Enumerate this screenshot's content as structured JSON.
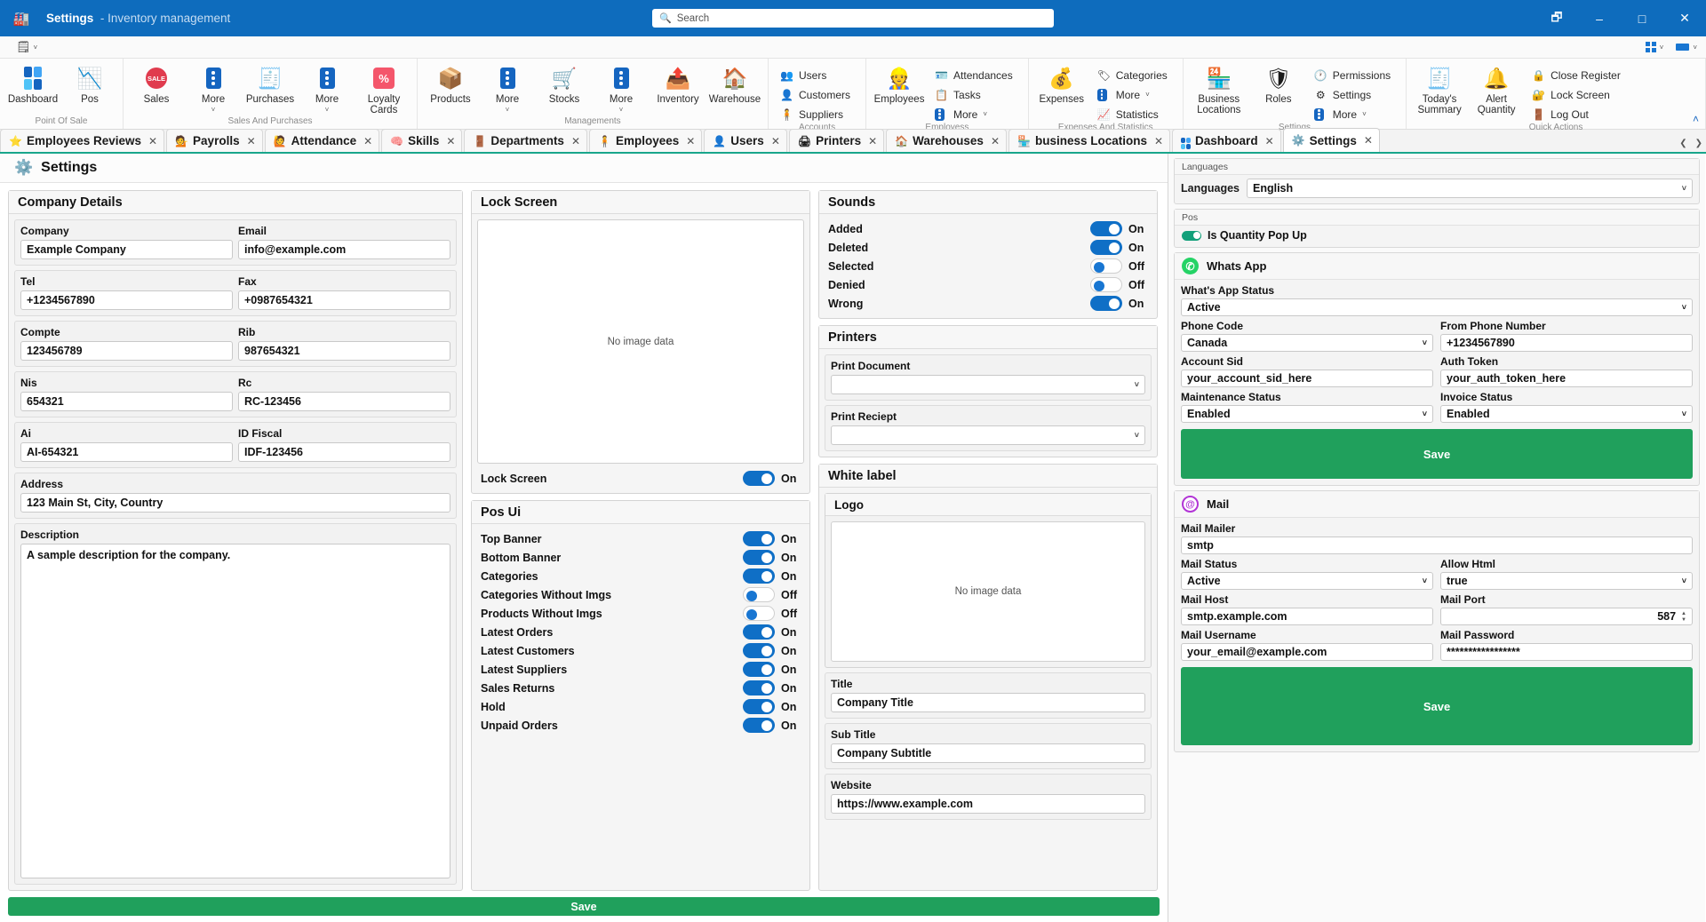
{
  "titlebar": {
    "app_icon": "factory-icon",
    "title": "Settings",
    "subtitle": "- Inventory management",
    "search_placeholder": "Search",
    "buttons": [
      "panel-icon",
      "minimize",
      "maximize",
      "close"
    ]
  },
  "ribbon_strip": {
    "menu_icon": "hamburger-doc-icon",
    "right_chips": [
      "grid-view",
      "blue-bar-view"
    ]
  },
  "ribbon": {
    "groups": [
      {
        "label": "Point Of Sale",
        "big": [
          {
            "icon": "dashboard-icon",
            "label": "Dashboard"
          },
          {
            "icon": "pos-icon",
            "label": "Pos"
          }
        ]
      },
      {
        "label": "Sales And Purchases",
        "big": [
          {
            "icon": "sale-badge-icon",
            "label": "Sales"
          },
          {
            "icon": "more-dots-icon",
            "label": "More",
            "chevron": true
          },
          {
            "icon": "purchases-icon",
            "label": "Purchases"
          },
          {
            "icon": "more-dots-icon",
            "label": "More",
            "chevron": true
          },
          {
            "icon": "percent-icon",
            "label": "Loyalty Cards"
          }
        ]
      },
      {
        "label": "Managements",
        "big": [
          {
            "icon": "products-box-icon",
            "label": "Products"
          },
          {
            "icon": "more-dots-icon",
            "label": "More",
            "chevron": true
          },
          {
            "icon": "stocks-cart-icon",
            "label": "Stocks"
          },
          {
            "icon": "more-dots-icon",
            "label": "More",
            "chevron": true
          },
          {
            "icon": "inventory-icon",
            "label": "Inventory"
          },
          {
            "icon": "warehouse-icon",
            "label": "Warehouse"
          }
        ]
      },
      {
        "label": "Accounts",
        "small": [
          {
            "icon": "users-icon",
            "label": "Users"
          },
          {
            "icon": "customers-icon",
            "label": "Customers"
          },
          {
            "icon": "suppliers-icon",
            "label": "Suppliers"
          }
        ]
      },
      {
        "label": "Employess",
        "big": [
          {
            "icon": "employee-icon",
            "label": "Employees"
          }
        ],
        "small": [
          {
            "icon": "attendances-icon",
            "label": "Attendances"
          },
          {
            "icon": "tasks-icon",
            "label": "Tasks"
          },
          {
            "icon": "more-dots-icon",
            "label": "More",
            "chevron": true
          }
        ]
      },
      {
        "label": "Expenses And Statistics",
        "big": [
          {
            "icon": "expenses-icon",
            "label": "Expenses"
          }
        ],
        "small": [
          {
            "icon": "categories-tag-icon",
            "label": "Categories"
          },
          {
            "icon": "more-dots-icon",
            "label": "More",
            "chevron": true
          },
          {
            "icon": "statistics-icon",
            "label": "Statistics"
          }
        ]
      },
      {
        "label": "Settings",
        "big": [
          {
            "icon": "business-locations-icon",
            "label": "Business Locations"
          },
          {
            "icon": "roles-shield-icon",
            "label": "Roles"
          }
        ],
        "small": [
          {
            "icon": "permissions-icon",
            "label": "Permissions"
          },
          {
            "icon": "settings-gear-icon",
            "label": "Settings"
          },
          {
            "icon": "more-dots-icon",
            "label": "More",
            "chevron": true
          }
        ]
      },
      {
        "label": "Quick Actions",
        "big": [
          {
            "icon": "todays-summary-icon",
            "label": "Today's Summary"
          },
          {
            "icon": "alert-quantity-icon",
            "label": "Alert Quantity"
          }
        ],
        "small": [
          {
            "icon": "close-register-icon",
            "label": "Close Register"
          },
          {
            "icon": "lock-screen-icon",
            "label": "Lock Screen"
          },
          {
            "icon": "log-out-icon",
            "label": "Log Out"
          }
        ]
      }
    ]
  },
  "tabs": [
    {
      "icon": "star-icon",
      "label": "Employees Reviews",
      "active": false
    },
    {
      "icon": "payroll-icon",
      "label": "Payrolls",
      "active": false
    },
    {
      "icon": "attendance-icon",
      "label": "Attendance",
      "active": false
    },
    {
      "icon": "brain-icon",
      "label": "Skills",
      "active": false
    },
    {
      "icon": "department-icon",
      "label": "Departments",
      "active": false
    },
    {
      "icon": "employee-icon",
      "label": "Employees",
      "active": false
    },
    {
      "icon": "user-icon",
      "label": "Users",
      "active": false
    },
    {
      "icon": "printer-icon",
      "label": "Printers",
      "active": false
    },
    {
      "icon": "warehouse-icon",
      "label": "Warehouses",
      "active": false
    },
    {
      "icon": "store-icon",
      "label": "business Locations",
      "active": false
    },
    {
      "icon": "dashboard-icon",
      "label": "Dashboard",
      "active": false
    },
    {
      "icon": "settings-gear-icon",
      "label": "Settings",
      "active": true
    }
  ],
  "page": {
    "icon": "settings-gear-icon",
    "title": "Settings"
  },
  "company_details": {
    "header": "Company Details",
    "fields": [
      {
        "label": "Company",
        "value": "Example Company"
      },
      {
        "label": "Email",
        "value": "info@example.com"
      },
      {
        "label": "Tel",
        "value": "+1234567890"
      },
      {
        "label": "Fax",
        "value": "+0987654321"
      },
      {
        "label": "Compte",
        "value": "123456789"
      },
      {
        "label": "Rib",
        "value": "987654321"
      },
      {
        "label": "Nis",
        "value": "654321"
      },
      {
        "label": "Rc",
        "value": "RC-123456"
      },
      {
        "label": "Ai",
        "value": "AI-654321"
      },
      {
        "label": "ID Fiscal",
        "value": "IDF-123456"
      }
    ],
    "address": {
      "label": "Address",
      "value": "123 Main St, City, Country"
    },
    "description": {
      "label": "Description",
      "value": "A sample description for the company."
    }
  },
  "lock_screen": {
    "header": "Lock Screen",
    "image_placeholder": "No image data",
    "toggle": {
      "label": "Lock Screen",
      "state": "On",
      "on": true
    }
  },
  "pos_ui": {
    "header": "Pos Ui",
    "toggles": [
      {
        "label": "Top Banner",
        "state": "On",
        "on": true
      },
      {
        "label": "Bottom Banner",
        "state": "On",
        "on": true
      },
      {
        "label": "Categories",
        "state": "On",
        "on": true
      },
      {
        "label": "Categories Without Imgs",
        "state": "Off",
        "on": false
      },
      {
        "label": "Products Without Imgs",
        "state": "Off",
        "on": false
      },
      {
        "label": "Latest Orders",
        "state": "On",
        "on": true
      },
      {
        "label": "Latest Customers",
        "state": "On",
        "on": true
      },
      {
        "label": "Latest Suppliers",
        "state": "On",
        "on": true
      },
      {
        "label": "Sales Returns",
        "state": "On",
        "on": true
      },
      {
        "label": "Hold",
        "state": "On",
        "on": true
      },
      {
        "label": "Unpaid Orders",
        "state": "On",
        "on": true
      }
    ]
  },
  "sounds": {
    "header": "Sounds",
    "toggles": [
      {
        "label": "Added",
        "state": "On",
        "on": true
      },
      {
        "label": "Deleted",
        "state": "On",
        "on": true
      },
      {
        "label": "Selected",
        "state": "Off",
        "on": false
      },
      {
        "label": "Denied",
        "state": "Off",
        "on": false
      },
      {
        "label": "Wrong",
        "state": "On",
        "on": true
      }
    ]
  },
  "printers": {
    "header": "Printers",
    "selects": [
      {
        "label": "Print Document",
        "value": ""
      },
      {
        "label": "Print Reciept",
        "value": ""
      }
    ]
  },
  "white_label": {
    "header": "White label",
    "logo": {
      "header": "Logo",
      "image_placeholder": "No image data"
    },
    "fields": [
      {
        "label": "Title",
        "value": "Company Title"
      },
      {
        "label": "Sub Title",
        "value": "Company Subtitle"
      },
      {
        "label": "Website",
        "value": "https://www.example.com"
      }
    ]
  },
  "main_save": {
    "label": "Save"
  },
  "right_panel": {
    "languages": {
      "header": "Languages",
      "label": "Languages",
      "value": "English"
    },
    "pos": {
      "header": "Pos",
      "toggle": {
        "label": "Is Quantity Pop Up",
        "on": true
      }
    },
    "whatsapp": {
      "icon": "whatsapp-icon",
      "title": "Whats App",
      "fields": [
        {
          "label": "What's App Status",
          "value": "Active",
          "type": "select",
          "full": true
        },
        {
          "label": "Phone Code",
          "value": "Canada",
          "type": "select"
        },
        {
          "label": "From Phone Number",
          "value": "+1234567890",
          "type": "input"
        },
        {
          "label": "Account Sid",
          "value": "your_account_sid_here",
          "type": "input"
        },
        {
          "label": "Auth Token",
          "value": "your_auth_token_here",
          "type": "input"
        },
        {
          "label": "Maintenance Status",
          "value": "Enabled",
          "type": "select"
        },
        {
          "label": "Invoice Status",
          "value": "Enabled",
          "type": "select"
        }
      ],
      "save_label": "Save"
    },
    "mail": {
      "icon": "mail-at-icon",
      "title": "Mail",
      "fields": [
        {
          "label": "Mail Mailer",
          "value": "smtp",
          "type": "input",
          "full": true
        },
        {
          "label": "Mail Status",
          "value": "Active",
          "type": "select"
        },
        {
          "label": "Allow Html",
          "value": "true",
          "type": "select"
        },
        {
          "label": "Mail Host",
          "value": "smtp.example.com",
          "type": "input"
        },
        {
          "label": "Mail Port",
          "value": "587",
          "type": "spinner"
        },
        {
          "label": "Mail Username",
          "value": "your_email@example.com",
          "type": "input"
        },
        {
          "label": "Mail Password",
          "value": "*****************",
          "type": "password"
        }
      ],
      "save_label": "Save"
    }
  },
  "colors": {
    "titlebar": "#0e6cbd",
    "accent_tab_underline": "#18a58b",
    "save_green": "#20a05c",
    "switch_on": "#0f6fc6",
    "whatsapp_green": "#25d366",
    "mail_purple": "#b234d6"
  }
}
